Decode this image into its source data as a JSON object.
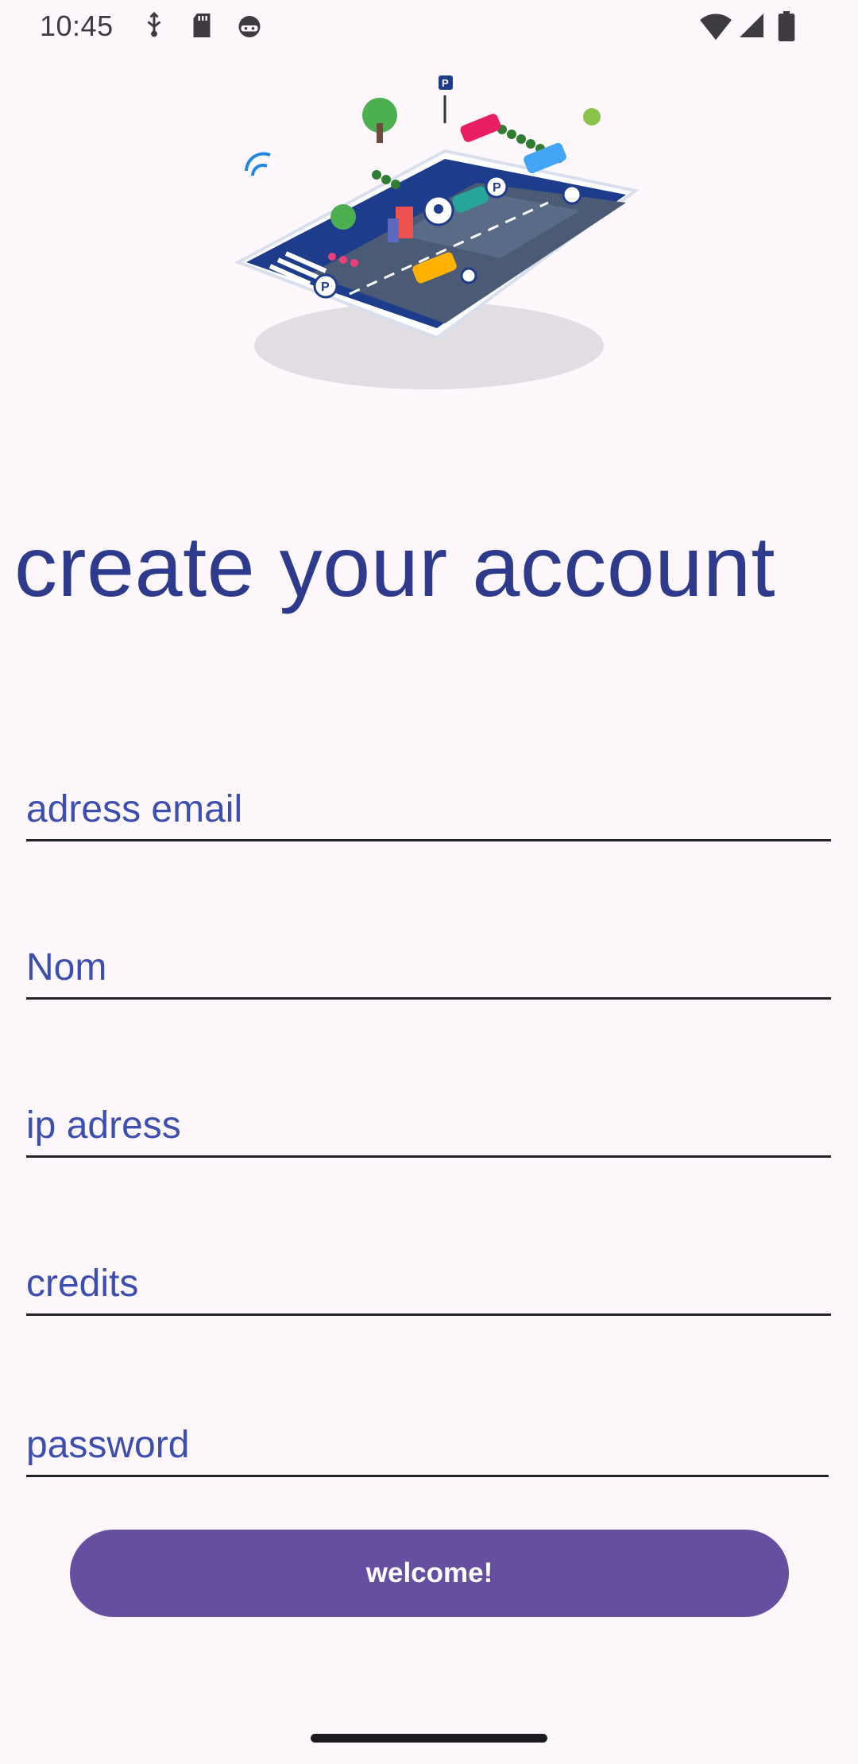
{
  "status_bar": {
    "time": "10:45",
    "icons_left": [
      "usb-debug-icon",
      "sd-card-icon",
      "android-head-icon"
    ],
    "icons_right": [
      "wifi-icon",
      "cell-signal-icon",
      "battery-icon"
    ]
  },
  "hero": {
    "icon": "smart-parking-illustration"
  },
  "title": "create your account",
  "form": {
    "email": {
      "placeholder": "adress email",
      "value": ""
    },
    "name": {
      "placeholder": "Nom",
      "value": ""
    },
    "ip": {
      "placeholder": "ip adress",
      "value": ""
    },
    "credits": {
      "placeholder": "credits",
      "value": ""
    },
    "password": {
      "placeholder": "password",
      "value": ""
    },
    "submit_label": "welcome!"
  },
  "colors": {
    "background": "#fef8fc",
    "title": "#2e3a8c",
    "placeholder": "#3c4eb0",
    "button": "#664fa1"
  }
}
